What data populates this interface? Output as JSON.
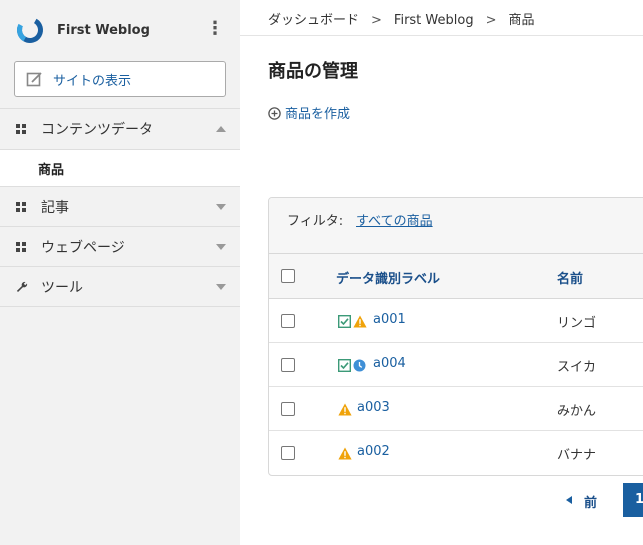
{
  "brand": {
    "name": "First Weblog"
  },
  "sidebar": {
    "view_site": "サイトの表示",
    "sections": [
      {
        "label": "コンテンツデータ",
        "expanded": true
      },
      {
        "label": "記事",
        "expanded": false
      },
      {
        "label": "ウェブページ",
        "expanded": false
      },
      {
        "label": "ツール",
        "expanded": false
      }
    ],
    "sub_item": "商品"
  },
  "breadcrumb": [
    "ダッシュボード",
    "First Weblog",
    "商品"
  ],
  "page": {
    "title": "商品の管理",
    "create_link": "商品を作成"
  },
  "filter": {
    "label": "フィルタ:",
    "value": "すべての商品"
  },
  "table": {
    "columns": [
      "データ識別ラベル",
      "名前"
    ],
    "rows": [
      {
        "id": "a001",
        "name": "リンゴ",
        "icons": [
          "published-icon",
          "warning-icon"
        ]
      },
      {
        "id": "a004",
        "name": "スイカ",
        "icons": [
          "published-icon",
          "scheduled-icon"
        ]
      },
      {
        "id": "a003",
        "name": "みかん",
        "icons": [
          "warning-icon"
        ]
      },
      {
        "id": "a002",
        "name": "バナナ",
        "icons": [
          "warning-icon"
        ]
      }
    ]
  },
  "pager": {
    "prev": "前",
    "current": "1"
  },
  "colors": {
    "link": "#1a5fa0",
    "sidebar_bg": "#f2f2f2",
    "warning": "#f0a30a",
    "published": "#3c9a78",
    "scheduled": "#3f8fd6"
  }
}
